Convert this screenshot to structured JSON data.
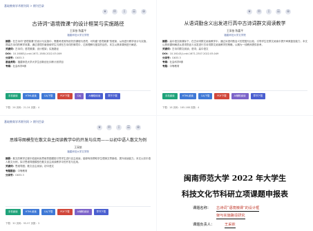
{
  "panel1": {
    "breadcrumb": "基础教育学术期刊网 > 期刊目录",
    "tools": [
      "★",
      "✉",
      "⇩",
      "☰",
      "⊕"
    ],
    "title": "古诗词“语境微课”的设计框架与实施路径",
    "author": "王采依  陈嘉平",
    "institution": "福建师范大学文学院",
    "abstract_label": "摘要：",
    "abstract": "在古诗词“语境微课”的设计与实施中，需要考虑其所依托的课程与语境，可构建“语境微课”的框架，从而进行教学设计与实施，提高古诗词的教学效果。通过语境的营造使学生沉浸在古诗词的情境中，达到理解与鉴赏的目的。本文以具体课例进行阐述。",
    "keywords_label": "关键词：",
    "keywords": "古诗词；语境微课；设计框架；实施路径",
    "doi_label": "DOI：",
    "doi": "10.16083/j.cnki.1671-1580.2022.03.009",
    "cls_label": "分类号：",
    "cls": "G633.3",
    "fund_label": "基金资助：",
    "fund": "福建师范大学大学生创新创业训练计划项目",
    "issue_label": "专辑：",
    "issue": "社会科学Ⅱ辑",
    "buttons": [
      {
        "label": "手机阅读",
        "color": "#1fa37a"
      },
      {
        "label": "HTML阅读",
        "color": "#3f79d6"
      },
      {
        "label": "CAJ下载",
        "color": "#3f79d6"
      },
      {
        "label": "PDF下载",
        "color": "#d0463a"
      },
      {
        "label": "CAJ",
        "color": "#7b62c9"
      },
      {
        "label": "AI辅助阅读",
        "color": "#4a5fd0"
      },
      {
        "label": "章节下载",
        "color": "#4a5fd0"
      }
    ],
    "footer": "下载：26   页码：21-24   页数：4"
  },
  "panel2": {
    "breadcrumb": "",
    "tools": [
      "★",
      "✉",
      "⇩",
      "☰",
      "⊕"
    ],
    "title": "从语词勤含义出发进行高中古诗词群文阅读教学",
    "author": "王采依  陈嘉平",
    "institution": "福建师范大学文学院",
    "abstract_label": "摘要：",
    "abstract": "高中语文新课标下，在古诗词群文阅读教学中，通过对语词勤含义的挖掘与比较，引导学生在群文阅读中提升审美鉴赏能力，本文以具体课例阐述从语词勤含义出发进行古诗词群文阅读教学的策略，以期为一线教师提供参考。",
    "keywords_label": "关键词：",
    "keywords": "古诗词群文阅读；语词；高中语文",
    "doi_label": "DOI：",
    "doi": "10.16143/j.cnki.1671-2307.2022.05.049",
    "cls_label": "分类号：",
    "cls": "G633.3",
    "fund_label": "专辑：",
    "fund": "社会科学Ⅱ辑",
    "issue_label": "专题：",
    "issue": "中等教育",
    "buttons": [
      {
        "label": "手机阅读",
        "color": "#1fa37a"
      },
      {
        "label": "HTML阅读",
        "color": "#3f79d6"
      },
      {
        "label": "CAJ下载",
        "color": "#3f79d6"
      },
      {
        "label": "PDF下载",
        "color": "#d0463a"
      },
      {
        "label": "AI辅助阅读",
        "color": "#7b62c9"
      },
      {
        "label": "章节下载",
        "color": "#4a5fd0"
      }
    ],
    "footer": "下载：18   页码：165-168   页数：4"
  },
  "panel3": {
    "breadcrumb": "基础教育学术期刊网 > 期刊目录",
    "tools": [
      "★",
      "✉",
      "⇩",
      "☰",
      "⊕"
    ],
    "title": "思维导图模型在散文自主阅读教学中的开发与应用——以初中语人散文为例",
    "author": "王采依",
    "institution": "福建师范大学文学院",
    "abstract_label": "摘要：",
    "abstract": "散文的教学过程中若能利用思维导图模型引导学生进行自主阅读，能够有效帮助学生理清文章脉络、提升阅读能力。本文以初中语人散文为例，探讨思维导图模型在散文自主阅读教学中的开发与应用。",
    "keywords_label": "关键词：",
    "keywords": "思维导图；散文自主阅读；初中语文",
    "doi_label": "专题题目：",
    "doi": "中等教育",
    "cls_label": "分类号：",
    "cls": "G633.3",
    "buttons": [
      {
        "label": "手机阅读",
        "color": "#1fa37a"
      },
      {
        "label": "HTML阅读",
        "color": "#3f79d6"
      },
      {
        "label": "CAJ下载",
        "color": "#3f79d6"
      },
      {
        "label": "PDF下载",
        "color": "#d0463a"
      },
      {
        "label": "AI辅助阅读",
        "color": "#7b62c9"
      },
      {
        "label": "章节下载",
        "color": "#4a5fd0"
      }
    ],
    "footer": "下载：30   页码：95-97   页数：3"
  },
  "panel4": {
    "title_line1": "闽南师范大学 2022 年大学生",
    "title_line2": "科技文化节科研立项课题申报表",
    "topic_label": "课题名称：",
    "topic_line1": "古诗词“语境微课”的设计框",
    "topic_line2": "架与实施路径研究",
    "leader_label": "课题负责人：",
    "leader": "王采依"
  }
}
